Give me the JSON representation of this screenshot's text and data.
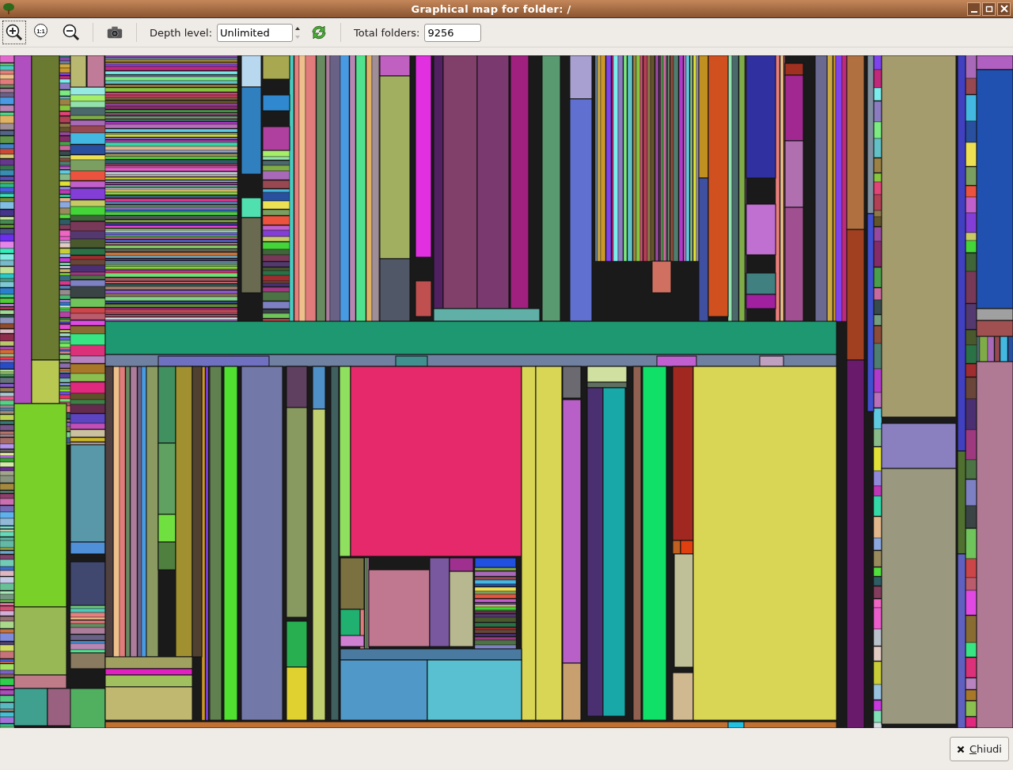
{
  "window": {
    "title": "Graphical map for folder: /"
  },
  "toolbar": {
    "zoom_reset_label": "1:1",
    "depth_label": "Depth level:",
    "depth_value": "Unlimited",
    "spin_down_disabled": true,
    "total_label": "Total folders:",
    "total_value": "9256"
  },
  "buttons": [
    {
      "label": "Chiudi"
    }
  ]
}
